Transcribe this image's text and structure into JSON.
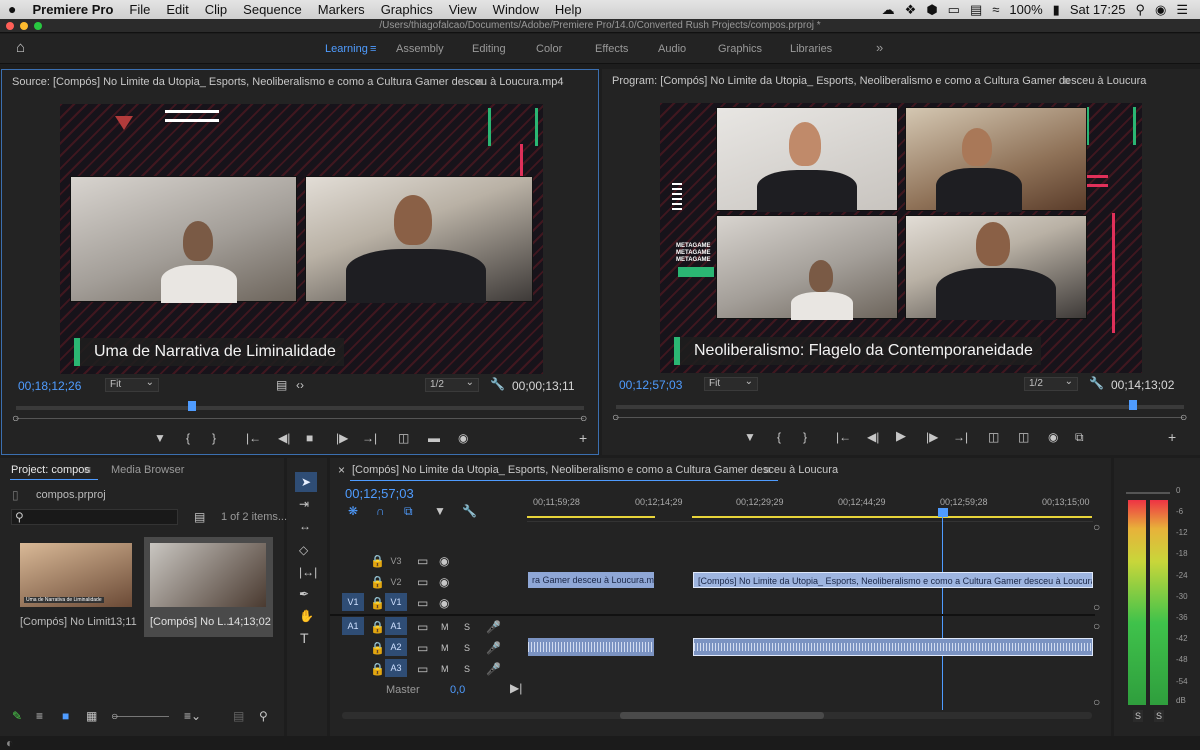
{
  "menubar": {
    "apple": "",
    "app": "Premiere Pro",
    "items": [
      "File",
      "Edit",
      "Clip",
      "Sequence",
      "Markers",
      "Graphics",
      "View",
      "Window",
      "Help"
    ],
    "battery": "100%",
    "clock": "Sat 17:25"
  },
  "window": {
    "title": "/Users/thiagofalcao/Documents/Adobe/Premiere Pro/14.0/Converted Rush Projects/compos.prproj *"
  },
  "workspaces": {
    "tabs": [
      "Learning",
      "Assembly",
      "Editing",
      "Color",
      "Effects",
      "Audio",
      "Graphics",
      "Libraries"
    ],
    "active": "Learning",
    "more": "»"
  },
  "source": {
    "title": "Source: [Compós] No Limite da Utopia_ Esports, Neoliberalismo e como a Cultura Gamer desceu à Loucura.mp4",
    "caption": "Uma de Narrativa de Liminalidade",
    "timecode": "00;18;12;26",
    "fit": "Fit",
    "resolution": "1/2",
    "duration": "00;00;13;11",
    "playhead_fraction": 0.31
  },
  "program": {
    "title": "Program: [Compós] No Limite da Utopia_ Esports, Neoliberalismo e como a Cultura Gamer desceu à Loucura",
    "caption": "Neoliberalismo: Flagelo da Contemporaneidade",
    "metagame": [
      "METAGAME",
      "METAGAME",
      "METAGAME"
    ],
    "timecode": "00;12;57;03",
    "fit": "Fit",
    "resolution": "1/2",
    "duration": "00;14;13;02",
    "playhead_fraction": 0.91
  },
  "project": {
    "tab": "Project: compos",
    "media_tab": "Media Browser",
    "file": "compos.prproj",
    "count": "1 of 2 items...",
    "items": [
      {
        "name": "[Compós] No Limit...",
        "duration": "13;11",
        "thumb_caption": "Uma de Narrativa de Liminalidade"
      },
      {
        "name": "[Compós] No L...",
        "duration": "14;13;02"
      }
    ]
  },
  "timeline": {
    "title": "[Compós] No Limite da Utopia_ Esports, Neoliberalismo e como a Cultura Gamer desceu à Loucura",
    "timecode": "00;12;57;03",
    "ruler": [
      "00;11;59;28",
      "00;12;14;29",
      "00;12;29;29",
      "00;12;44;29",
      "00;12;59;28",
      "00;13;15;00"
    ],
    "video_tracks": [
      "V3",
      "V2",
      "V1"
    ],
    "audio_tracks": [
      "A1",
      "A2",
      "A3"
    ],
    "source_v": "V1",
    "source_a": "A1",
    "mute": "M",
    "solo": "S",
    "master": "Master",
    "master_value": "0,0",
    "clip_left": "ra Gamer desceu à Loucura.mp4 [V]",
    "clip_right": "[Compós] No Limite da Utopia_ Esports, Neoliberalismo e como a Cultura Gamer desceu à Loucura.mp4 [V]"
  },
  "meter": {
    "scale": [
      "0",
      "-6",
      "-12",
      "-18",
      "-24",
      "-30",
      "-36",
      "-42",
      "-48",
      "-54",
      "dB"
    ],
    "solo": "S"
  },
  "colors": {
    "accent": "#4f9cff",
    "clip": "#8fa7d6",
    "caption_bar": "#2bb673",
    "pink": "#e0305a"
  }
}
